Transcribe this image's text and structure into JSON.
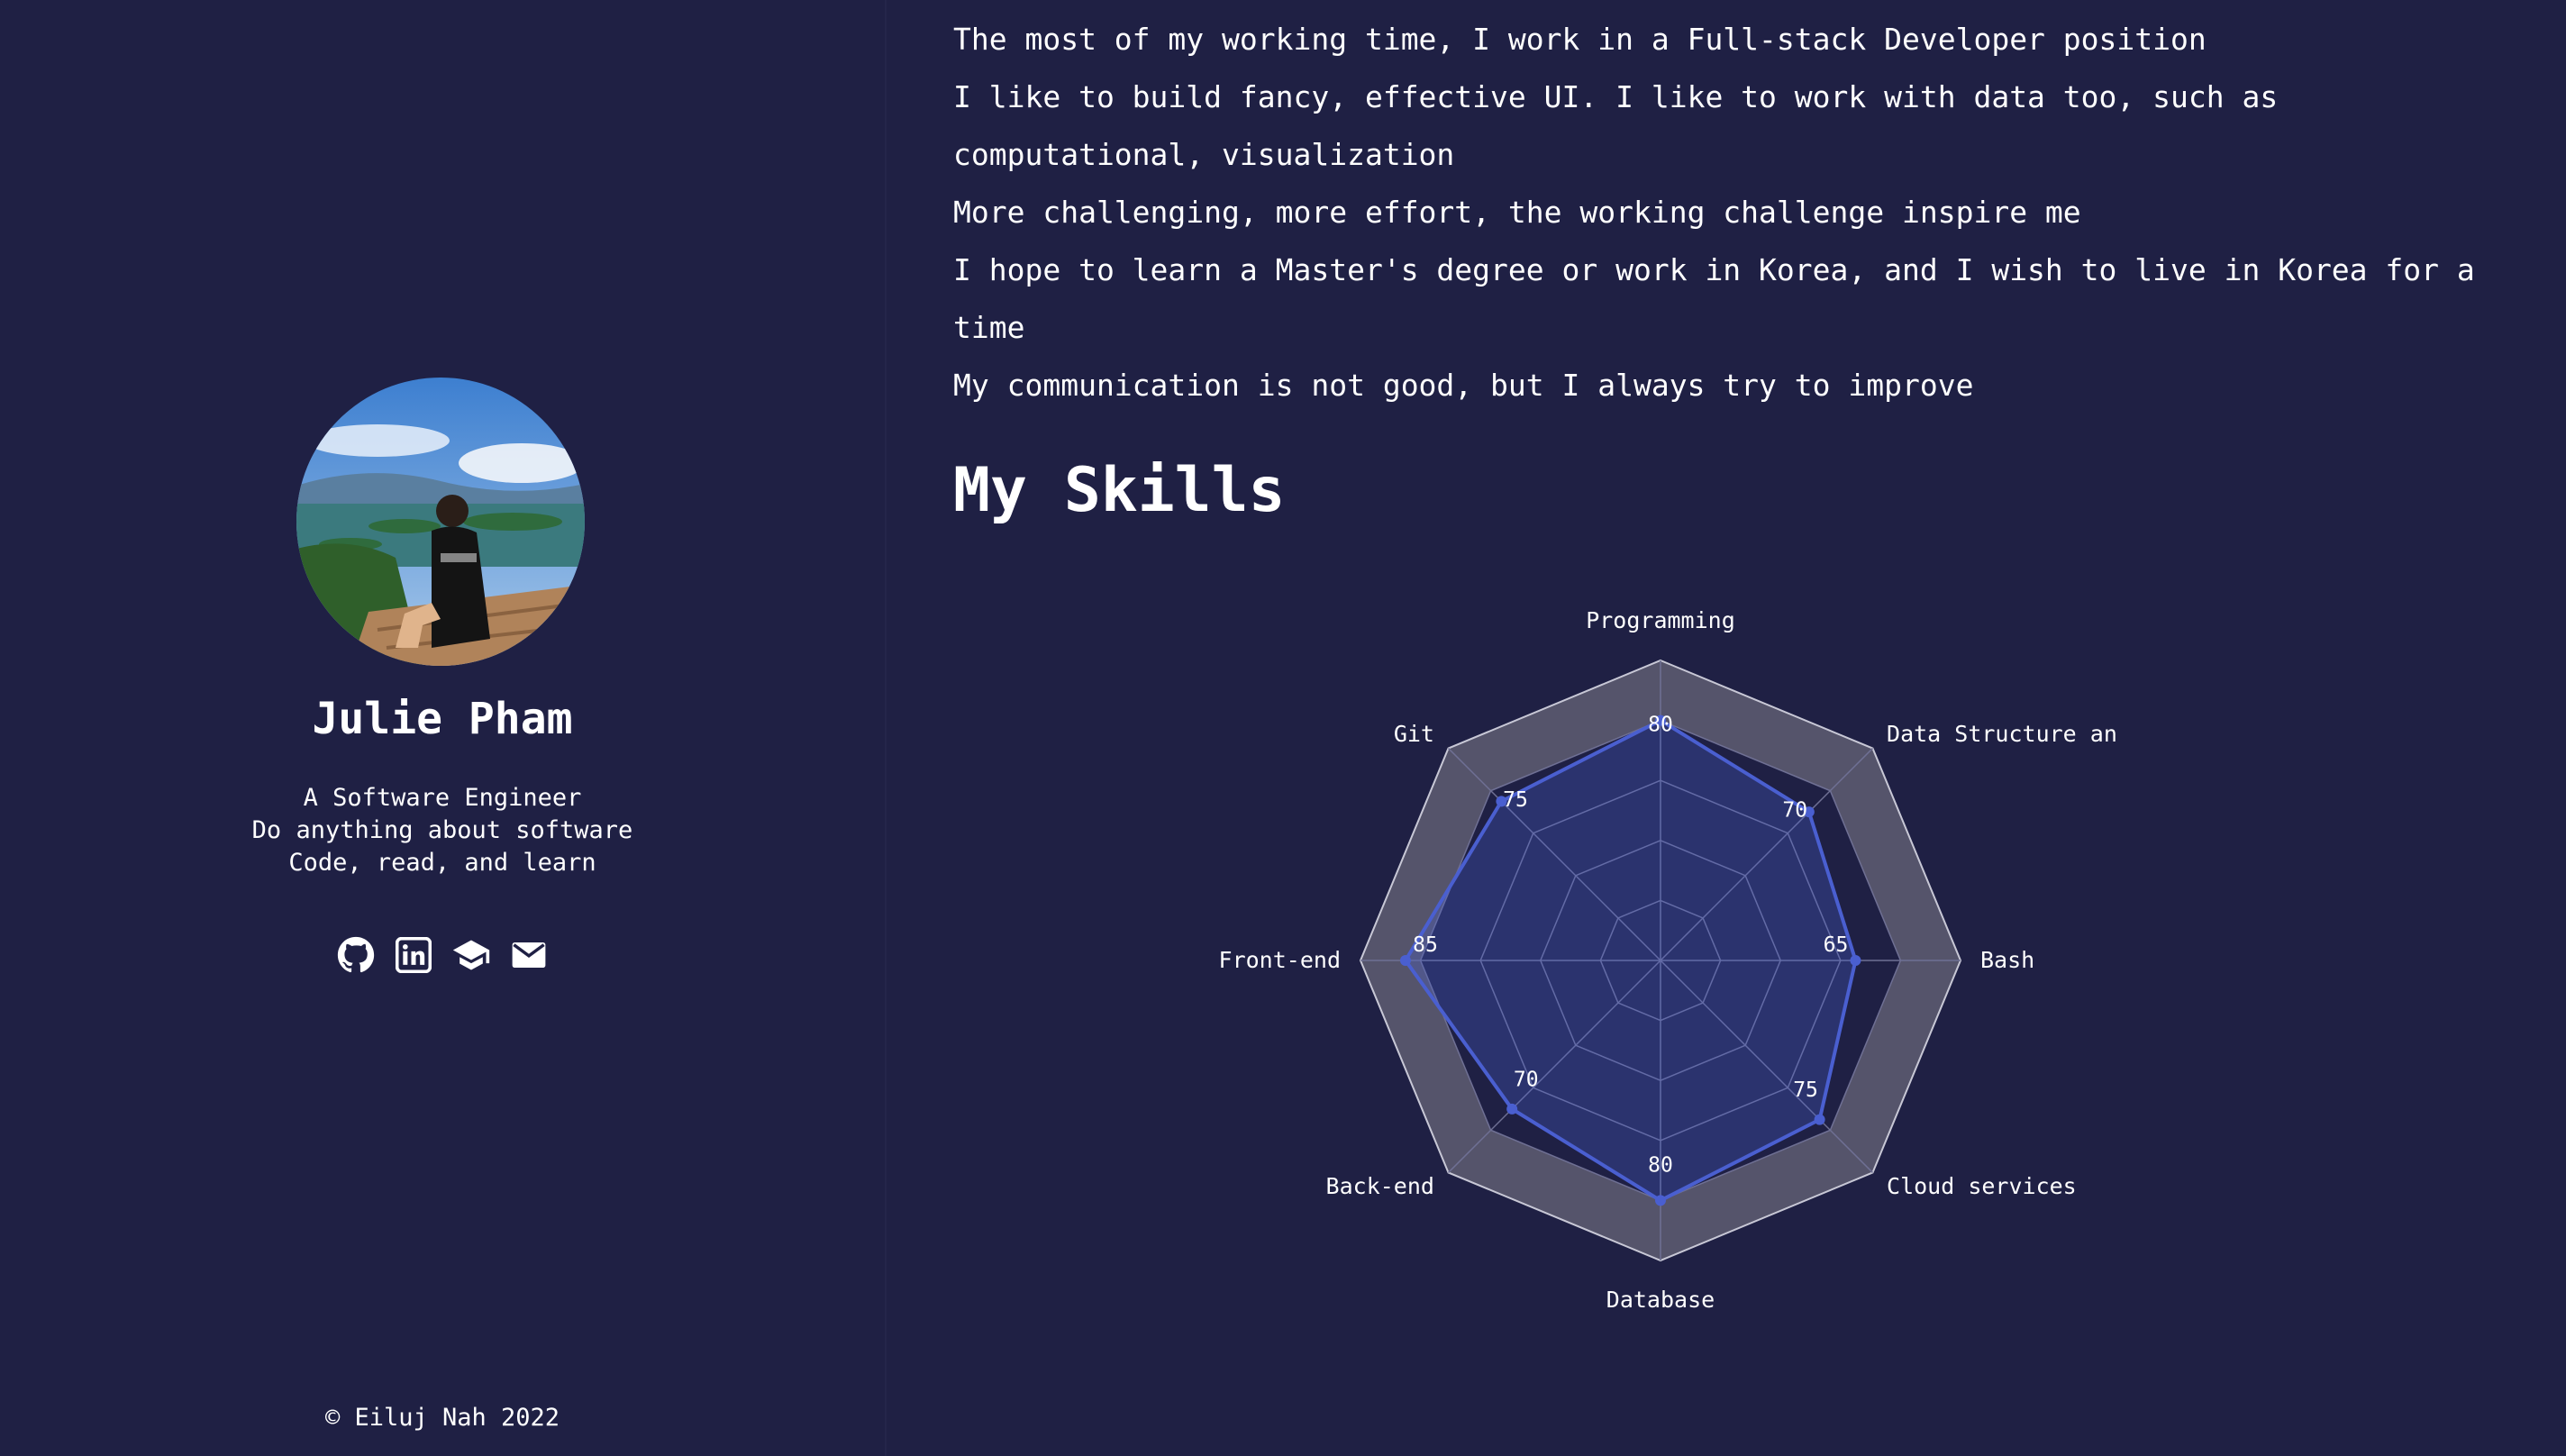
{
  "profile": {
    "name": "Julie Pham",
    "tagline": [
      "A Software Engineer",
      "Do anything about software",
      "Code, read, and learn"
    ],
    "socials": [
      {
        "icon": "github-icon"
      },
      {
        "icon": "linkedin-icon"
      },
      {
        "icon": "graduation-cap-icon"
      },
      {
        "icon": "email-icon"
      }
    ],
    "footer": "© Eiluj Nah 2022"
  },
  "about": [
    "The most of my working time, I work in a Full-stack Developer position",
    "I like to build fancy, effective UI. I like to work with data too, such as computational, visualization",
    "More challenging, more effort, the working challenge inspire me",
    "I hope to learn a Master's degree or work in Korea, and I wish to live in Korea for a time",
    "My communication is not good, but I always try to improve"
  ],
  "skills_title": "My Skills",
  "colors": {
    "background": "#1f2044",
    "series": "#4a5fd0",
    "ring": "#55546b"
  },
  "chart_data": {
    "type": "radar",
    "categories": [
      "Programming",
      "Data Structure and Algorithm",
      "Bash",
      "Cloud services",
      "Database",
      "Back-end",
      "Front-end",
      "Git"
    ],
    "values": [
      80,
      70,
      65,
      75,
      80,
      70,
      85,
      75
    ],
    "ylim": [
      0,
      100
    ]
  }
}
